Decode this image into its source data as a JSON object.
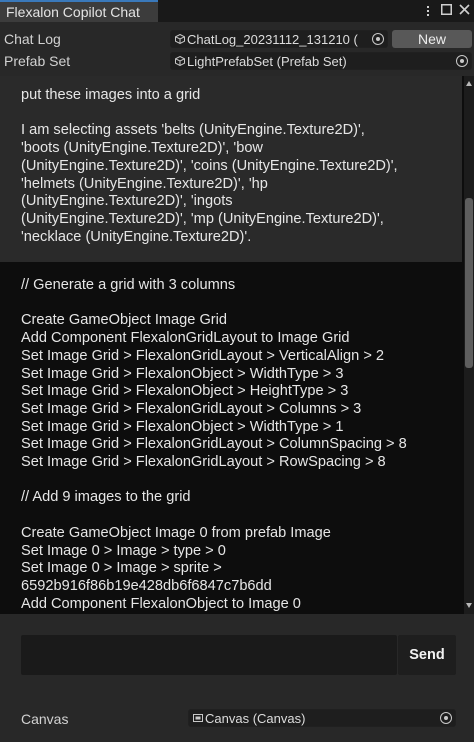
{
  "window": {
    "tab_title": "Flexalon Copilot Chat",
    "icons": [
      "more-icon",
      "maximize-icon",
      "close-icon"
    ]
  },
  "fields": {
    "chat_log": {
      "label": "Chat Log",
      "value": "ChatLog_20231112_131210 (",
      "icon": "scriptable-object-icon"
    },
    "new_button": "New",
    "prefab_set": {
      "label": "Prefab Set",
      "value": "LightPrefabSet (Prefab Set)",
      "icon": "scriptable-object-icon"
    }
  },
  "chat": {
    "user_message": [
      "put these images into a grid",
      "",
      "I am selecting assets 'belts (UnityEngine.Texture2D)',",
      "'boots (UnityEngine.Texture2D)', 'bow",
      "(UnityEngine.Texture2D)', 'coins (UnityEngine.Texture2D)',",
      "'helmets (UnityEngine.Texture2D)', 'hp",
      "(UnityEngine.Texture2D)', 'ingots",
      "(UnityEngine.Texture2D)', 'mp (UnityEngine.Texture2D)',",
      "'necklace (UnityEngine.Texture2D)'."
    ],
    "assistant_message": [
      "// Generate a grid with 3 columns",
      "",
      "Create GameObject Image Grid",
      "Add Component FlexalonGridLayout to Image Grid",
      "Set Image Grid > FlexalonGridLayout > VerticalAlign > 2",
      "Set Image Grid > FlexalonObject > WidthType > 3",
      "Set Image Grid > FlexalonObject > HeightType > 3",
      "Set Image Grid > FlexalonGridLayout > Columns > 3",
      "Set Image Grid > FlexalonObject > WidthType > 1",
      "Set Image Grid > FlexalonGridLayout > ColumnSpacing > 8",
      "Set Image Grid > FlexalonGridLayout > RowSpacing > 8",
      "",
      "// Add 9 images to the grid",
      "",
      "Create GameObject Image 0 from prefab Image",
      "Set Image 0 > Image > type > 0",
      "Set Image 0 > Image > sprite >",
      "6592b916f86b19e428db6f6847c7b6dd",
      "Add Component FlexalonObject to Image 0"
    ]
  },
  "input": {
    "value": "",
    "send_label": "Send"
  },
  "footer": {
    "canvas": {
      "label": "Canvas",
      "value": "Canvas (Canvas)",
      "icon": "canvas-icon"
    }
  },
  "colors": {
    "accent": "#3a79bb",
    "panel": "#282828",
    "chat_bg": "#0d0d0d",
    "user_msg_bg": "#2a2a2a"
  }
}
